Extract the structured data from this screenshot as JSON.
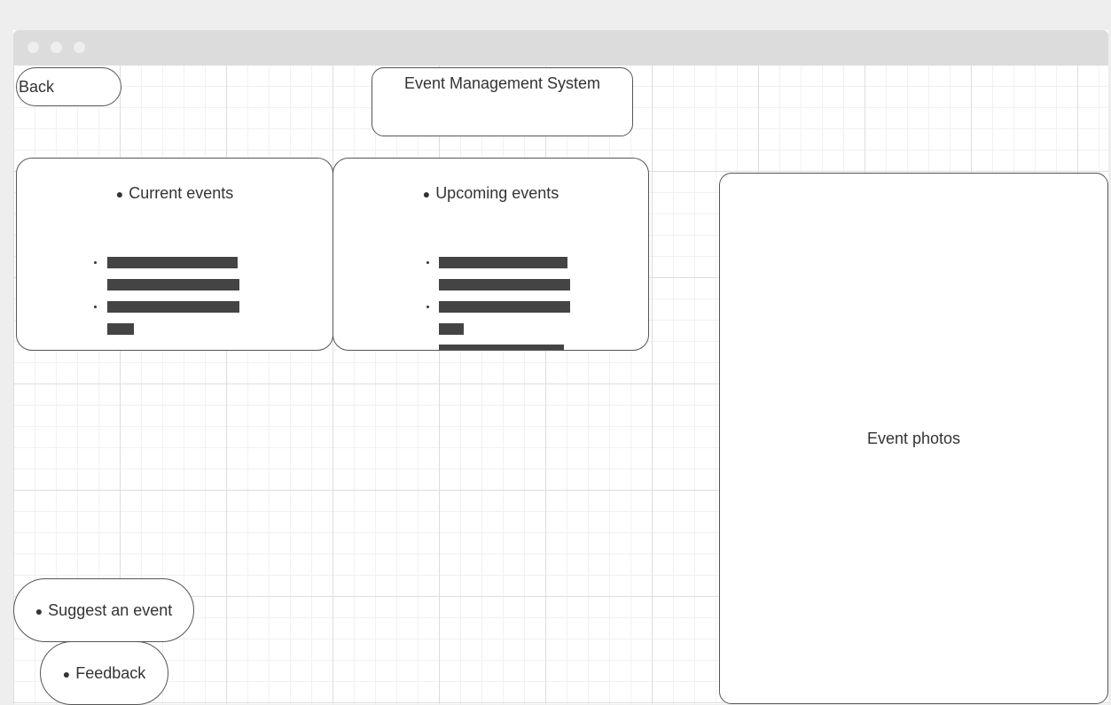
{
  "back_button": {
    "label": "Back"
  },
  "app_title": "Event Management System",
  "panels": {
    "current": {
      "label": "Current events"
    },
    "upcoming": {
      "label": "Upcoming events"
    }
  },
  "photos": {
    "label": "Event photos"
  },
  "actions": {
    "suggest": {
      "label": "Suggest an event"
    },
    "feedback": {
      "label": "Feedback"
    }
  },
  "bullet_symbol": "●",
  "colors": {
    "background": "#eeeeee",
    "titlebar": "#dcdcdc",
    "border": "#555555",
    "placeholder_bar": "#444444",
    "text": "#333333"
  }
}
